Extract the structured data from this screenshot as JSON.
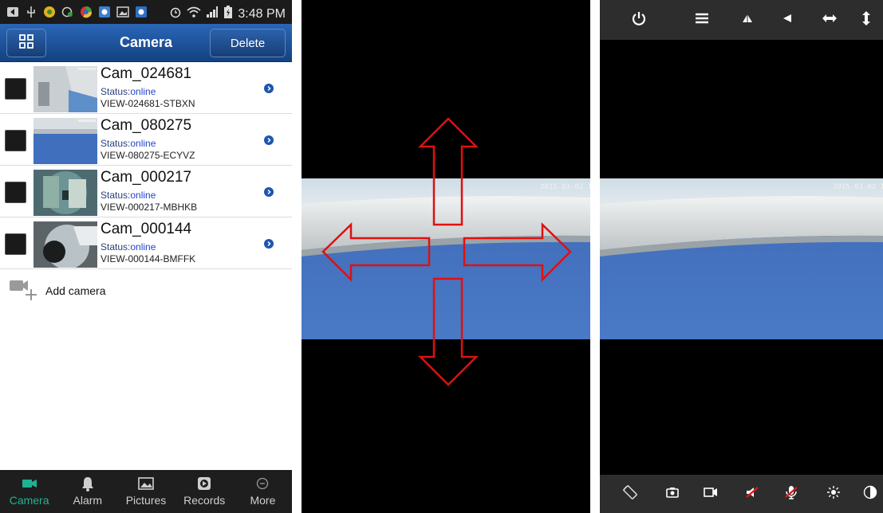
{
  "status_bar": {
    "time": "3:48 PM"
  },
  "header": {
    "title": "Camera",
    "delete_label": "Delete"
  },
  "cameras": [
    {
      "name": "Cam_024681",
      "status_label": "Status:",
      "status": "online",
      "id": "VIEW-024681-STBXN"
    },
    {
      "name": "Cam_080275",
      "status_label": "Status:",
      "status": "online",
      "id": "VIEW-080275-ECYVZ"
    },
    {
      "name": "Cam_000217",
      "status_label": "Status:",
      "status": "online",
      "id": "VIEW-000217-MBHKB"
    },
    {
      "name": "Cam_000144",
      "status_label": "Status:",
      "status": "online",
      "id": "VIEW-000144-BMFFK"
    }
  ],
  "add_camera": {
    "label": "Add camera"
  },
  "bottom_nav": [
    {
      "label": "Camera",
      "icon": "video-camera-icon",
      "active": true
    },
    {
      "label": "Alarm",
      "icon": "bell-icon",
      "active": false
    },
    {
      "label": "Pictures",
      "icon": "picture-icon",
      "active": false
    },
    {
      "label": "Records",
      "icon": "record-icon",
      "active": false
    },
    {
      "label": "More",
      "icon": "more-icon",
      "active": false
    }
  ],
  "video": {
    "timestamp": "2015-03-02 15:16:20"
  },
  "controls": {
    "top": [
      "power-icon",
      "menu-icon",
      "flip-up-icon",
      "flip-left-icon",
      "horizontal-patrol-icon",
      "vertical-patrol-icon"
    ],
    "bottom": [
      "rotate-icon",
      "snapshot-icon",
      "record-video-icon",
      "speaker-mute-icon",
      "mic-mute-icon",
      "brightness-icon",
      "contrast-icon"
    ]
  },
  "colors": {
    "header": "#1f56a0",
    "accent": "#1fb394",
    "link": "#2244cc",
    "arrow": "#e01010"
  }
}
